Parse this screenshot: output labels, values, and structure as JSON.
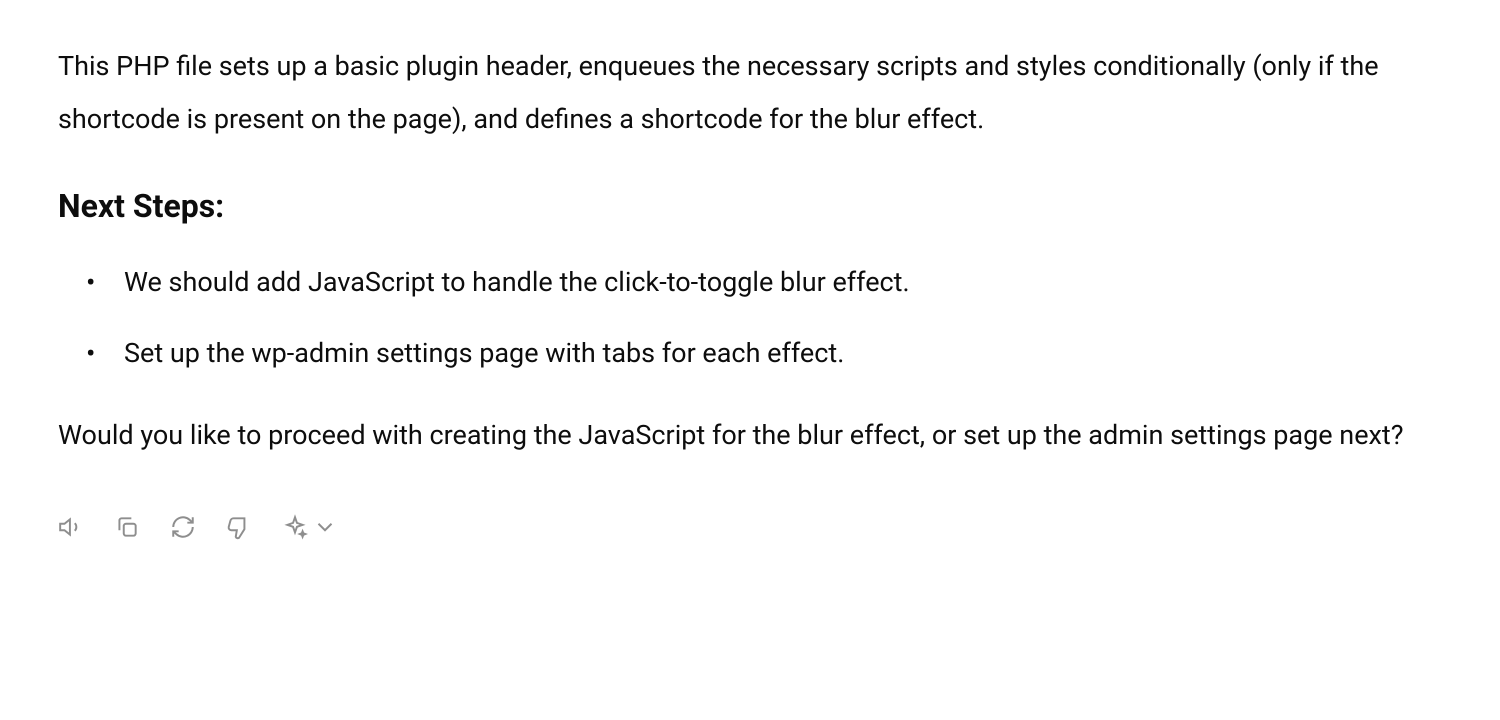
{
  "intro": "This PHP file sets up a basic plugin header, enqueues the necessary scripts and styles conditionally (only if the shortcode is present on the page), and defines a shortcode for the blur effect.",
  "heading": "Next Steps:",
  "bullets": [
    "We should add JavaScript to handle the click-to-toggle blur effect.",
    "Set up the wp-admin settings page with tabs for each effect."
  ],
  "closing": "Would you like to proceed with creating the JavaScript for the blur effect, or set up the admin settings page next?"
}
